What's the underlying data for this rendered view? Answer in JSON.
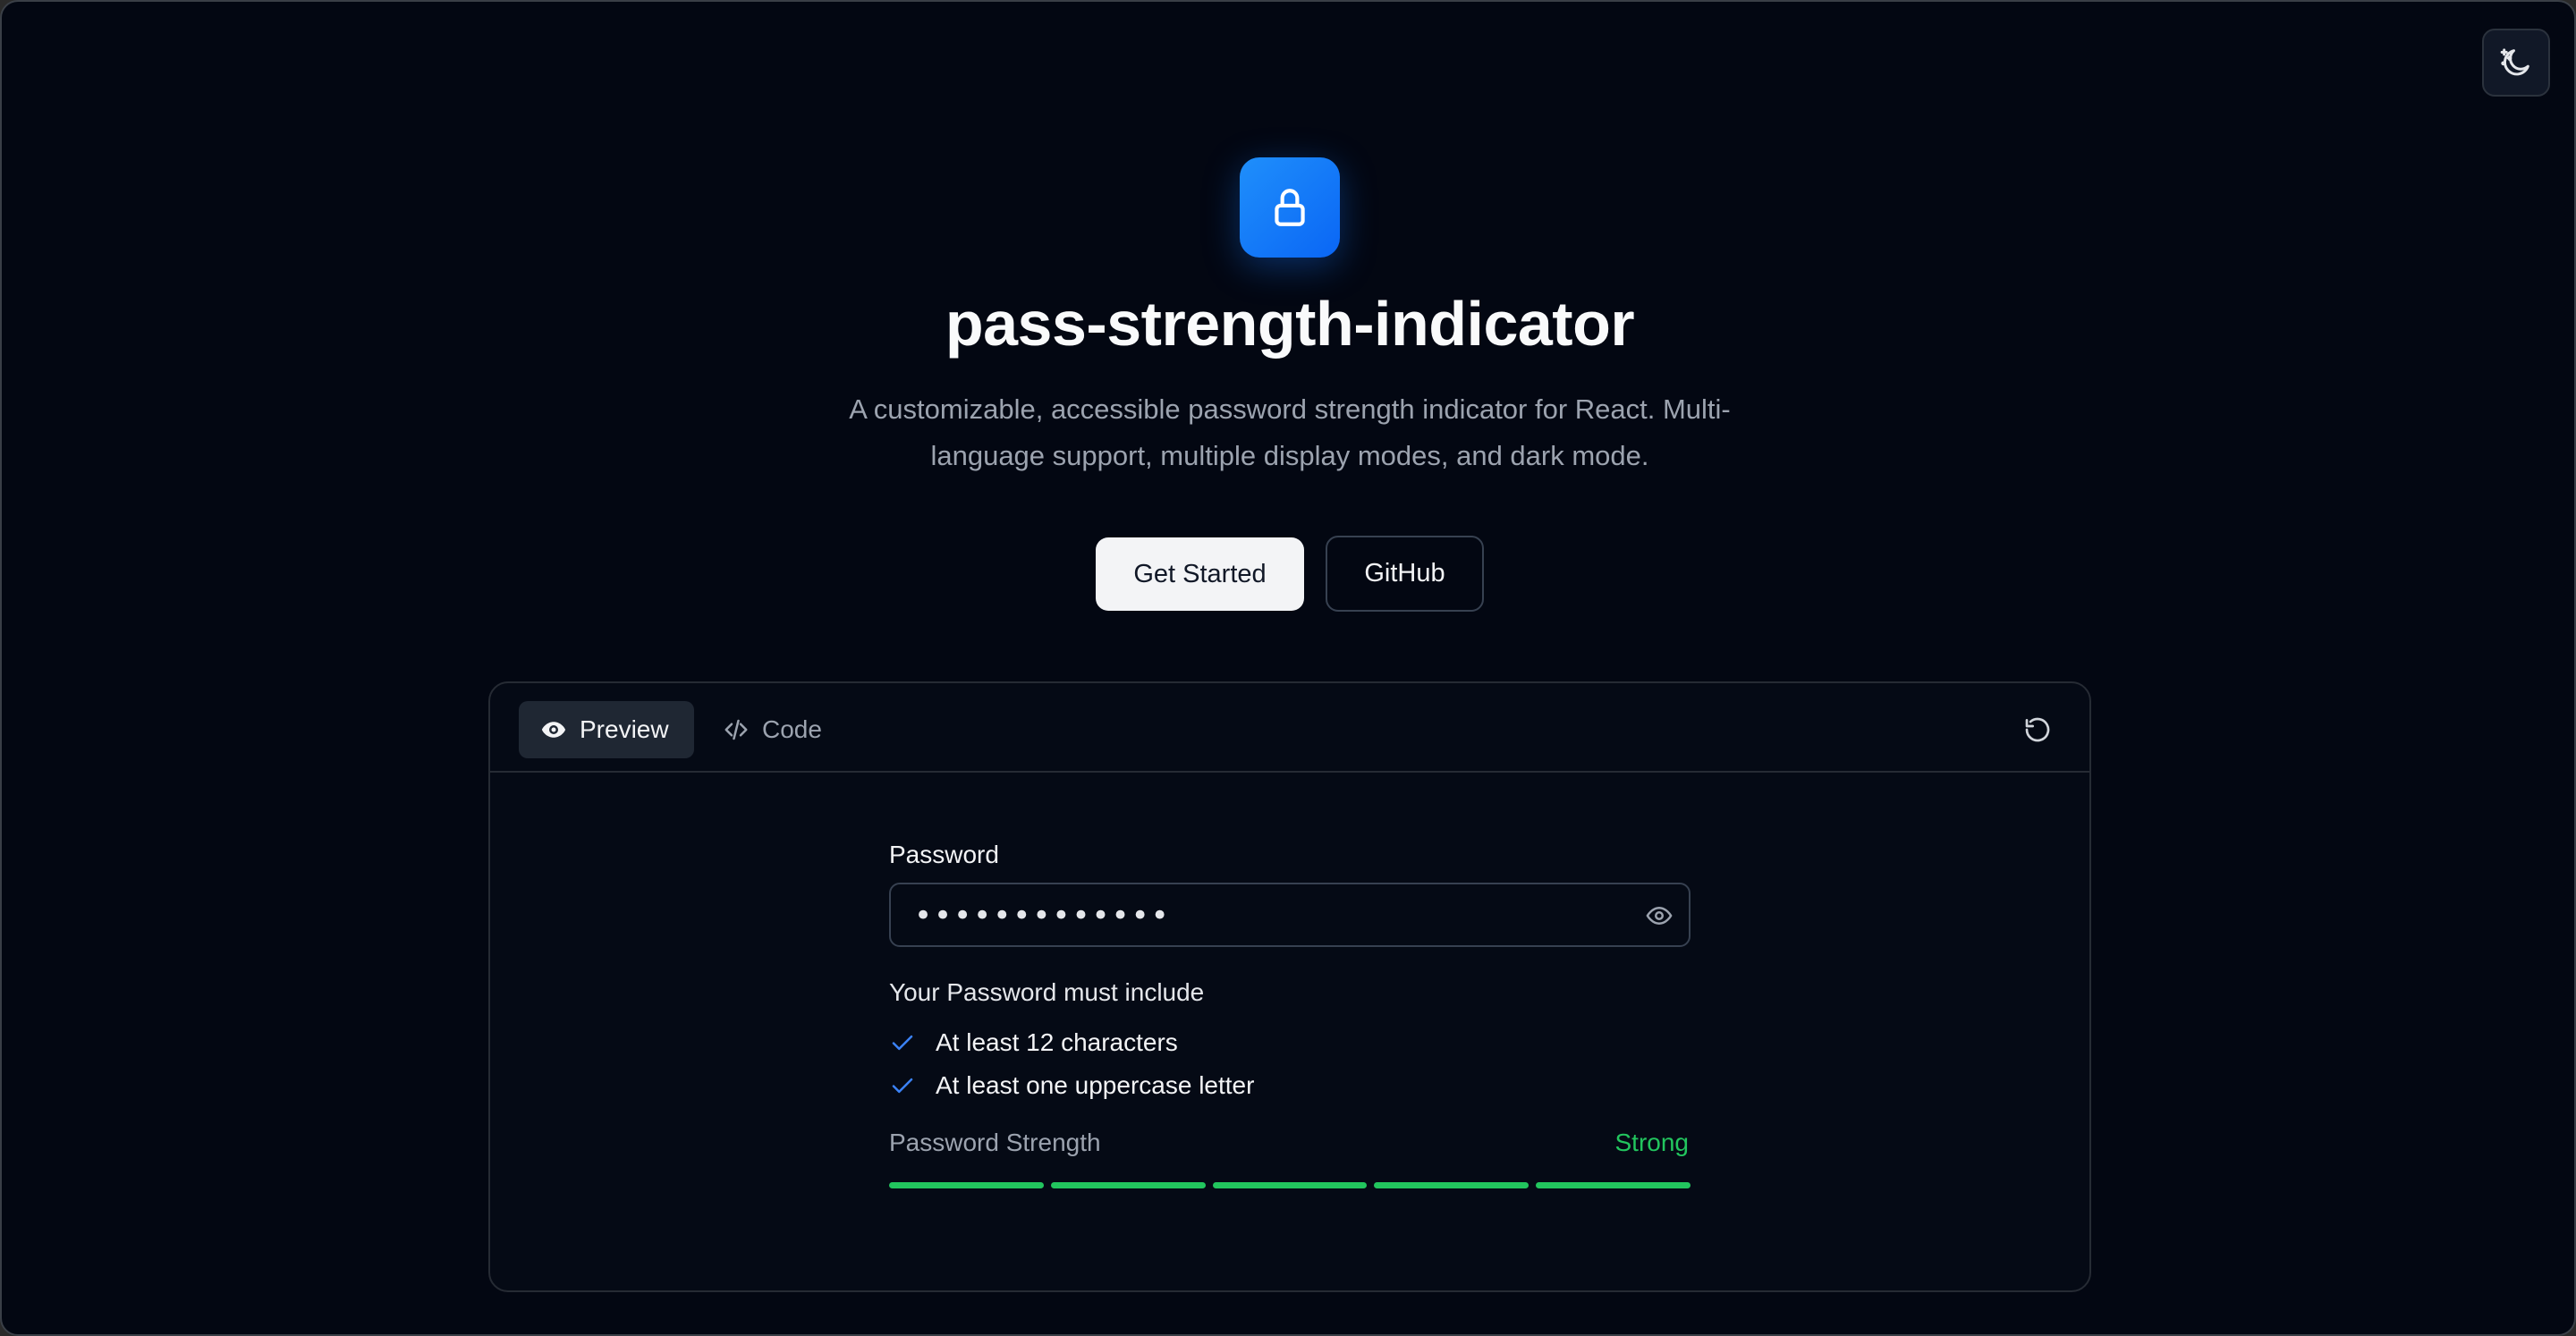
{
  "header": {
    "title": "pass-strength-indicator",
    "subtitle": "A customizable, accessible password strength indicator for React. Multi-language support, multiple display modes, and dark mode.",
    "logo_icon": "lock-icon",
    "accent_color": "#0a66f5"
  },
  "theme_toggle": {
    "icon": "moon-stars-icon"
  },
  "actions": {
    "primary_label": "Get Started",
    "secondary_label": "GitHub"
  },
  "demo": {
    "tabs": [
      {
        "label": "Preview",
        "icon": "eye-icon",
        "active": true
      },
      {
        "label": "Code",
        "icon": "code-icon",
        "active": false
      }
    ],
    "reset_icon": "refresh-icon",
    "password_label": "Password",
    "password_value": "•••••••••••••",
    "toggle_visibility_icon": "eye-icon",
    "requirements_title": "Your Password must include",
    "requirements": [
      {
        "text": "At least 12 characters",
        "met": true
      },
      {
        "text": "At least one uppercase letter",
        "met": true
      }
    ],
    "strength_label": "Password Strength",
    "strength_value": "Strong",
    "strength_color": "#22c55e",
    "strength_segments_filled": 5,
    "strength_segments_total": 5
  }
}
